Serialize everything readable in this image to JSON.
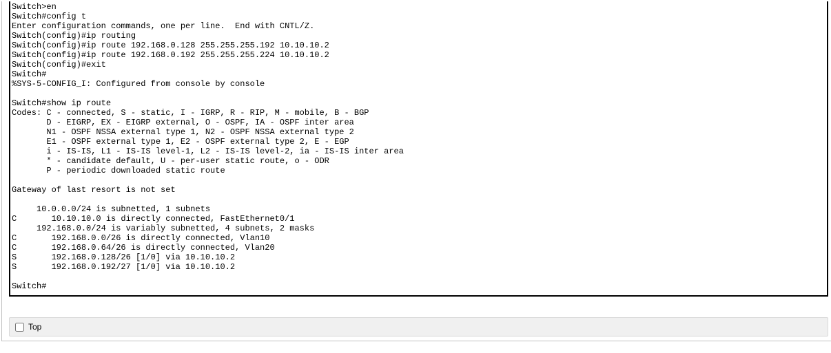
{
  "terminal": {
    "lines": [
      "Switch>en",
      "Switch#config t",
      "Enter configuration commands, one per line.  End with CNTL/Z.",
      "Switch(config)#ip routing",
      "Switch(config)#ip route 192.168.0.128 255.255.255.192 10.10.10.2",
      "Switch(config)#ip route 192.168.0.192 255.255.255.224 10.10.10.2",
      "Switch(config)#exit",
      "Switch#",
      "%SYS-5-CONFIG_I: Configured from console by console",
      "",
      "Switch#show ip route",
      "Codes: C - connected, S - static, I - IGRP, R - RIP, M - mobile, B - BGP",
      "       D - EIGRP, EX - EIGRP external, O - OSPF, IA - OSPF inter area",
      "       N1 - OSPF NSSA external type 1, N2 - OSPF NSSA external type 2",
      "       E1 - OSPF external type 1, E2 - OSPF external type 2, E - EGP",
      "       i - IS-IS, L1 - IS-IS level-1, L2 - IS-IS level-2, ia - IS-IS inter area",
      "       * - candidate default, U - per-user static route, o - ODR",
      "       P - periodic downloaded static route",
      "",
      "Gateway of last resort is not set",
      "",
      "     10.0.0.0/24 is subnetted, 1 subnets",
      "C       10.10.10.0 is directly connected, FastEthernet0/1",
      "     192.168.0.0/24 is variably subnetted, 4 subnets, 2 masks",
      "C       192.168.0.0/26 is directly connected, Vlan10",
      "C       192.168.0.64/26 is directly connected, Vlan20",
      "S       192.168.0.128/26 [1/0] via 10.10.10.2",
      "S       192.168.0.192/27 [1/0] via 10.10.10.2",
      "",
      "Switch#"
    ]
  },
  "footer": {
    "top_label": "Top"
  }
}
